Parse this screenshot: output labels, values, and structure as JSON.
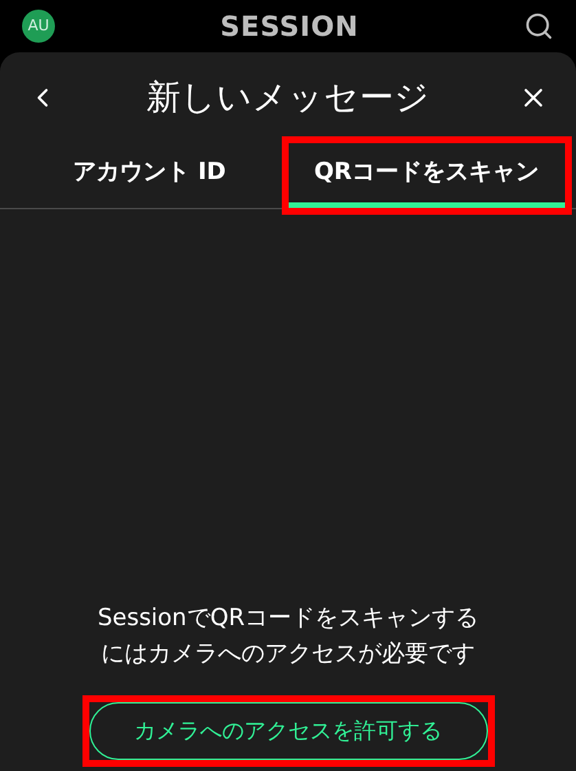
{
  "top_bar": {
    "avatar": "AU",
    "logo": "SESSION"
  },
  "sheet": {
    "title": "新しいメッセージ"
  },
  "tabs": [
    {
      "label": "アカウント ID",
      "selected": false,
      "highlighted": false
    },
    {
      "label": "QRコードをスキャン",
      "selected": true,
      "highlighted": true
    }
  ],
  "message": "SessionでQRコードをスキャンするにはカメラへのアクセスが必要です",
  "action_button": {
    "label": "カメラへのアクセスを許可する",
    "highlighted": true
  }
}
